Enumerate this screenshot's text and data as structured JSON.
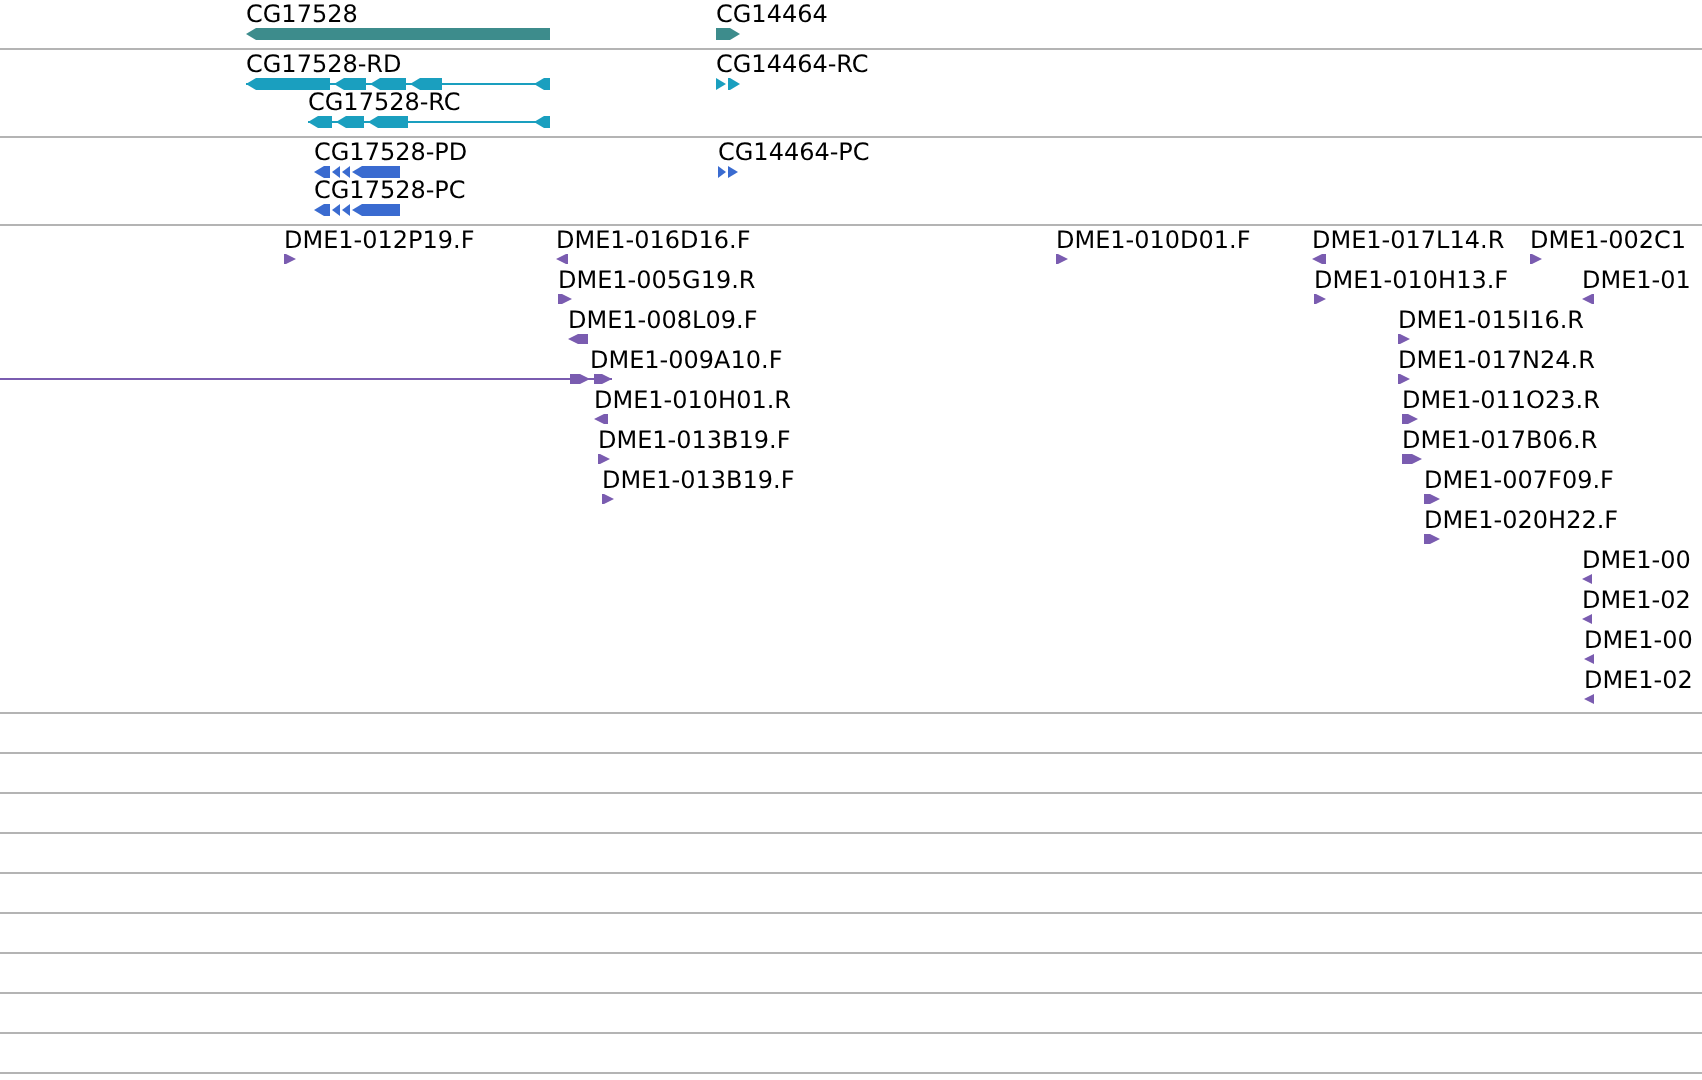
{
  "tracks": [
    {
      "kind": "gene",
      "features": [
        {
          "label": "CG17528",
          "forward": false
        },
        {
          "label": "CG14464",
          "forward": true
        }
      ]
    },
    {
      "kind": "transcript",
      "features": [
        {
          "label": "CG17528-RD",
          "forward": false
        },
        {
          "label": "CG17528-RC",
          "forward": false
        },
        {
          "label": "CG14464-RC",
          "forward": true
        }
      ]
    },
    {
      "kind": "protein",
      "features": [
        {
          "label": "CG17528-PD",
          "forward": false
        },
        {
          "label": "CG17528-PC",
          "forward": false
        },
        {
          "label": "CG14464-PC",
          "forward": true
        }
      ]
    },
    {
      "kind": "clone",
      "features": [
        {
          "label": "DME1-012P19.F",
          "forward": true
        },
        {
          "label": "DME1-016D16.F",
          "forward": false
        },
        {
          "label": "DME1-005G19.R",
          "forward": true
        },
        {
          "label": "DME1-008L09.F",
          "forward": false
        },
        {
          "label": "DME1-009A10.F",
          "forward": true
        },
        {
          "label": "DME1-010H01.R",
          "forward": false
        },
        {
          "label": "DME1-013B19.F",
          "forward": true
        },
        {
          "label": "DME1-013B19.F",
          "forward": true
        },
        {
          "label": "DME1-010D01.F",
          "forward": true
        },
        {
          "label": "DME1-017L14.R",
          "forward": false
        },
        {
          "label": "DME1-010H13.F",
          "forward": true
        },
        {
          "label": "DME1-002C1",
          "forward": true
        },
        {
          "label": "DME1-01",
          "forward": false
        },
        {
          "label": "DME1-015I16.R",
          "forward": true
        },
        {
          "label": "DME1-017N24.R",
          "forward": true
        },
        {
          "label": "DME1-011O23.R",
          "forward": true
        },
        {
          "label": "DME1-017B06.R",
          "forward": true
        },
        {
          "label": "DME1-007F09.F",
          "forward": true
        },
        {
          "label": "DME1-020H22.F",
          "forward": true
        },
        {
          "label": "DME1-00",
          "forward": false
        },
        {
          "label": "DME1-02",
          "forward": false
        },
        {
          "label": "DME1-00",
          "forward": false
        },
        {
          "label": "DME1-02",
          "forward": false
        }
      ]
    }
  ]
}
